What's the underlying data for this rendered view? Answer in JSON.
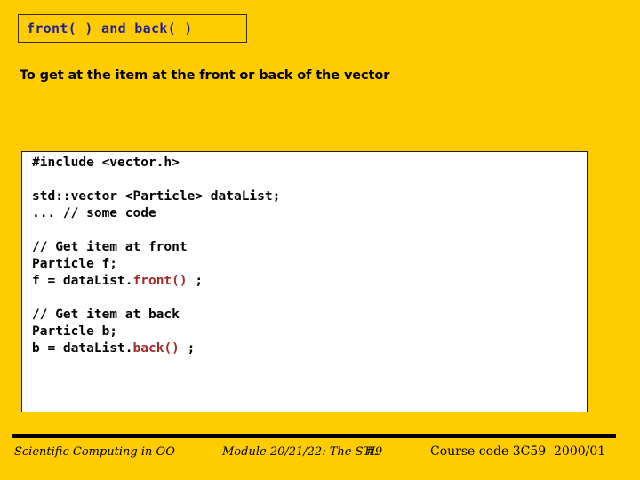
{
  "slide": {
    "background_color": "#FFCC00",
    "title": {
      "text": "front( ) and back( )",
      "color": "#1F1F8F",
      "border_color": "#3B2A12"
    },
    "subtitle": {
      "text": "To get at the item at the front or back of the vector",
      "color": "#000000"
    },
    "code_block": {
      "background_color": "#FFFFFF",
      "border_color": "#241A08",
      "text_color": "#000000",
      "highlight_color": "#A02B2B",
      "lines": [
        {
          "segments": [
            {
              "text": "#include <vector.h>",
              "highlight": false
            }
          ]
        },
        {
          "segments": [
            {
              "text": "",
              "highlight": false
            }
          ]
        },
        {
          "segments": [
            {
              "text": "std::vector <Particle> dataList;",
              "highlight": false
            }
          ]
        },
        {
          "segments": [
            {
              "text": "... // some code",
              "highlight": false
            }
          ]
        },
        {
          "segments": [
            {
              "text": "",
              "highlight": false
            }
          ]
        },
        {
          "segments": [
            {
              "text": "// Get item at front",
              "highlight": false
            }
          ]
        },
        {
          "segments": [
            {
              "text": "Particle f;",
              "highlight": false
            }
          ]
        },
        {
          "segments": [
            {
              "text": "f = dataList.",
              "highlight": false
            },
            {
              "text": "front()",
              "highlight": true
            },
            {
              "text": " ;",
              "highlight": false
            }
          ]
        },
        {
          "segments": [
            {
              "text": "",
              "highlight": false
            }
          ]
        },
        {
          "segments": [
            {
              "text": "// Get item at back",
              "highlight": false
            }
          ]
        },
        {
          "segments": [
            {
              "text": "Particle b;",
              "highlight": false
            }
          ]
        },
        {
          "segments": [
            {
              "text": "b = dataList.",
              "highlight": false
            },
            {
              "text": "back()",
              "highlight": true
            },
            {
              "text": " ;",
              "highlight": false
            }
          ]
        }
      ]
    },
    "footer": {
      "rule_color": "#000000",
      "course_title": "Scientific Computing in OO",
      "module": "Module 20/21/22: The STL",
      "page_number": "#9",
      "course_code": "Course code 3C59",
      "academic_year": "2000/01"
    }
  }
}
